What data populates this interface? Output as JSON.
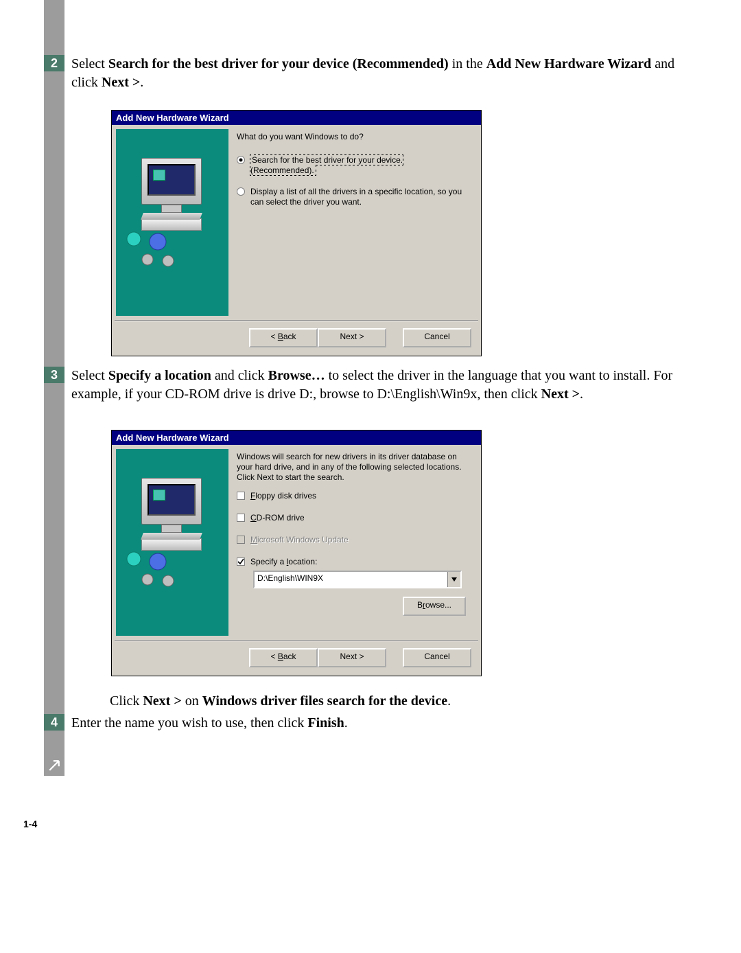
{
  "page_number": "1-4",
  "steps": {
    "s2": {
      "num": "2",
      "pre": "Select ",
      "b1": "Search for the best driver for your device (Recommended)",
      "mid1": " in the ",
      "b2": "Add New Hardware Wizard",
      "mid2": " and click ",
      "b3": "Next >",
      "post": "."
    },
    "s3": {
      "num": "3",
      "pre": "Select ",
      "b1": "Specify a location",
      "mid1": " and click ",
      "b2": "Browse…",
      "mid2": " to select the driver in the language that you want to install. For example, if your CD-ROM drive is drive D:, browse to D:\\English\\Win9x, then click ",
      "b3": "Next >",
      "post": "."
    },
    "s3b": {
      "pre": "Click ",
      "b1": "Next >",
      "mid": " on ",
      "b2": "Windows driver files search for the device",
      "post": "."
    },
    "s4": {
      "num": "4",
      "pre": "Enter the name you wish to use, then click ",
      "b1": "Finish",
      "post": "."
    }
  },
  "wizard_title": "Add New Hardware Wizard",
  "buttons": {
    "back": "< Back",
    "next": "Next >",
    "cancel": "Cancel",
    "browse": "Browse..."
  },
  "dlg1": {
    "prompt": "What do you want Windows to do?",
    "opt1a": "Search for the best driver for your device.",
    "opt1b": "(Recommended).",
    "opt2": "Display a list of all the drivers in a specific location, so you can select the driver you want."
  },
  "dlg2": {
    "intro": "Windows will search for new drivers in its driver database on your hard drive, and in any of the following selected locations. Click Next to start the search.",
    "cb_floppy": "Floppy disk drives",
    "cb_cd": "CD-ROM drive",
    "cb_msupdate": "Microsoft Windows Update",
    "cb_location": "Specify a location:",
    "path": "D:\\English\\WIN9X"
  }
}
